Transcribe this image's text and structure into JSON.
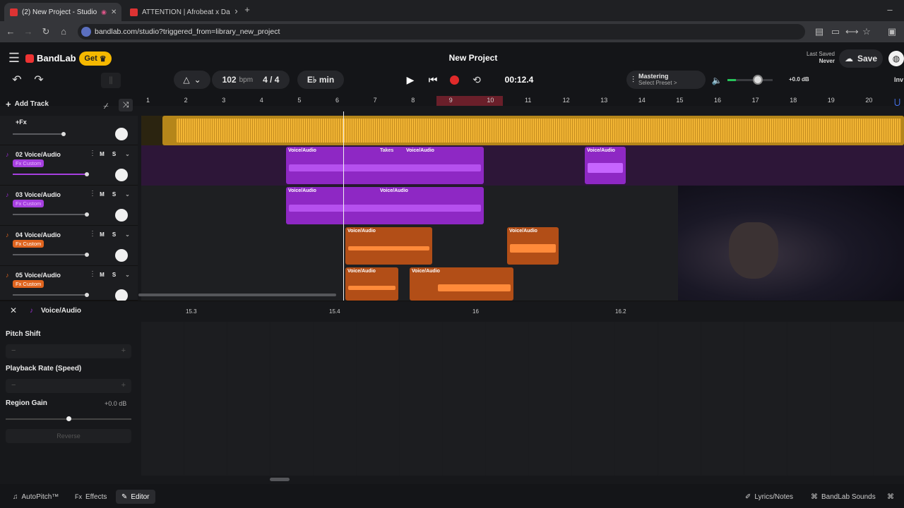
{
  "browser": {
    "tabs": [
      {
        "title": "(2) New Project - Studio",
        "active": true
      },
      {
        "title": "ATTENTION | Afrobeat x Da",
        "active": false
      }
    ],
    "url": "bandlab.com/studio?triggered_from=library_new_project"
  },
  "header": {
    "brand": "BandLab",
    "get_label": "Get",
    "project_title": "New Project",
    "last_saved_label": "Last Saved",
    "last_saved_value": "Never",
    "save_label": "Save",
    "invite_label": "Inv"
  },
  "transport": {
    "bpm_value": "102",
    "bpm_unit": "bpm",
    "time_signature": "4 / 4",
    "key": "E♭ min",
    "time": "00:12.4",
    "mastering_label": "Mastering",
    "mastering_sub": "Select Preset >",
    "volume_db": "+0.0 dB"
  },
  "toolbar": {
    "add_track_label": "Add Track"
  },
  "ruler": {
    "bars": [
      "1",
      "2",
      "3",
      "4",
      "5",
      "6",
      "7",
      "8",
      "9",
      "10",
      "11",
      "12",
      "13",
      "14",
      "15",
      "16",
      "17",
      "18",
      "19",
      "20"
    ],
    "loop_start": "9",
    "loop_end": "10"
  },
  "tracks": [
    {
      "name": "+Fx",
      "color": "#e8a820"
    },
    {
      "name": "02 Voice/Audio",
      "fx": "Fx Custom",
      "color": "#9b2fd6"
    },
    {
      "name": "03 Voice/Audio",
      "fx": "Fx Custom",
      "color": "#9b2fd6"
    },
    {
      "name": "04 Voice/Audio",
      "fx": "Fx Custom",
      "color": "#e0641e"
    },
    {
      "name": "05 Voice/Audio",
      "fx": "Fx Custom",
      "color": "#e0641e"
    }
  ],
  "clips": {
    "label": "Voice/Audio",
    "takes_label": "Takes"
  },
  "editor": {
    "title": "Voice/Audio",
    "timeline_marks": [
      "15.3",
      "15.4",
      "16",
      "16.2"
    ],
    "pitch_shift_label": "Pitch Shift",
    "playback_rate_label": "Playback Rate (Speed)",
    "region_gain_label": "Region Gain",
    "region_gain_value": "+0.0 dB",
    "reverse_label": "Reverse"
  },
  "bottom": {
    "autopitch_label": "AutoPitch™",
    "effects_label": "Effects",
    "editor_label": "Editor",
    "lyrics_label": "Lyrics/Notes",
    "sounds_label": "BandLab Sounds"
  }
}
